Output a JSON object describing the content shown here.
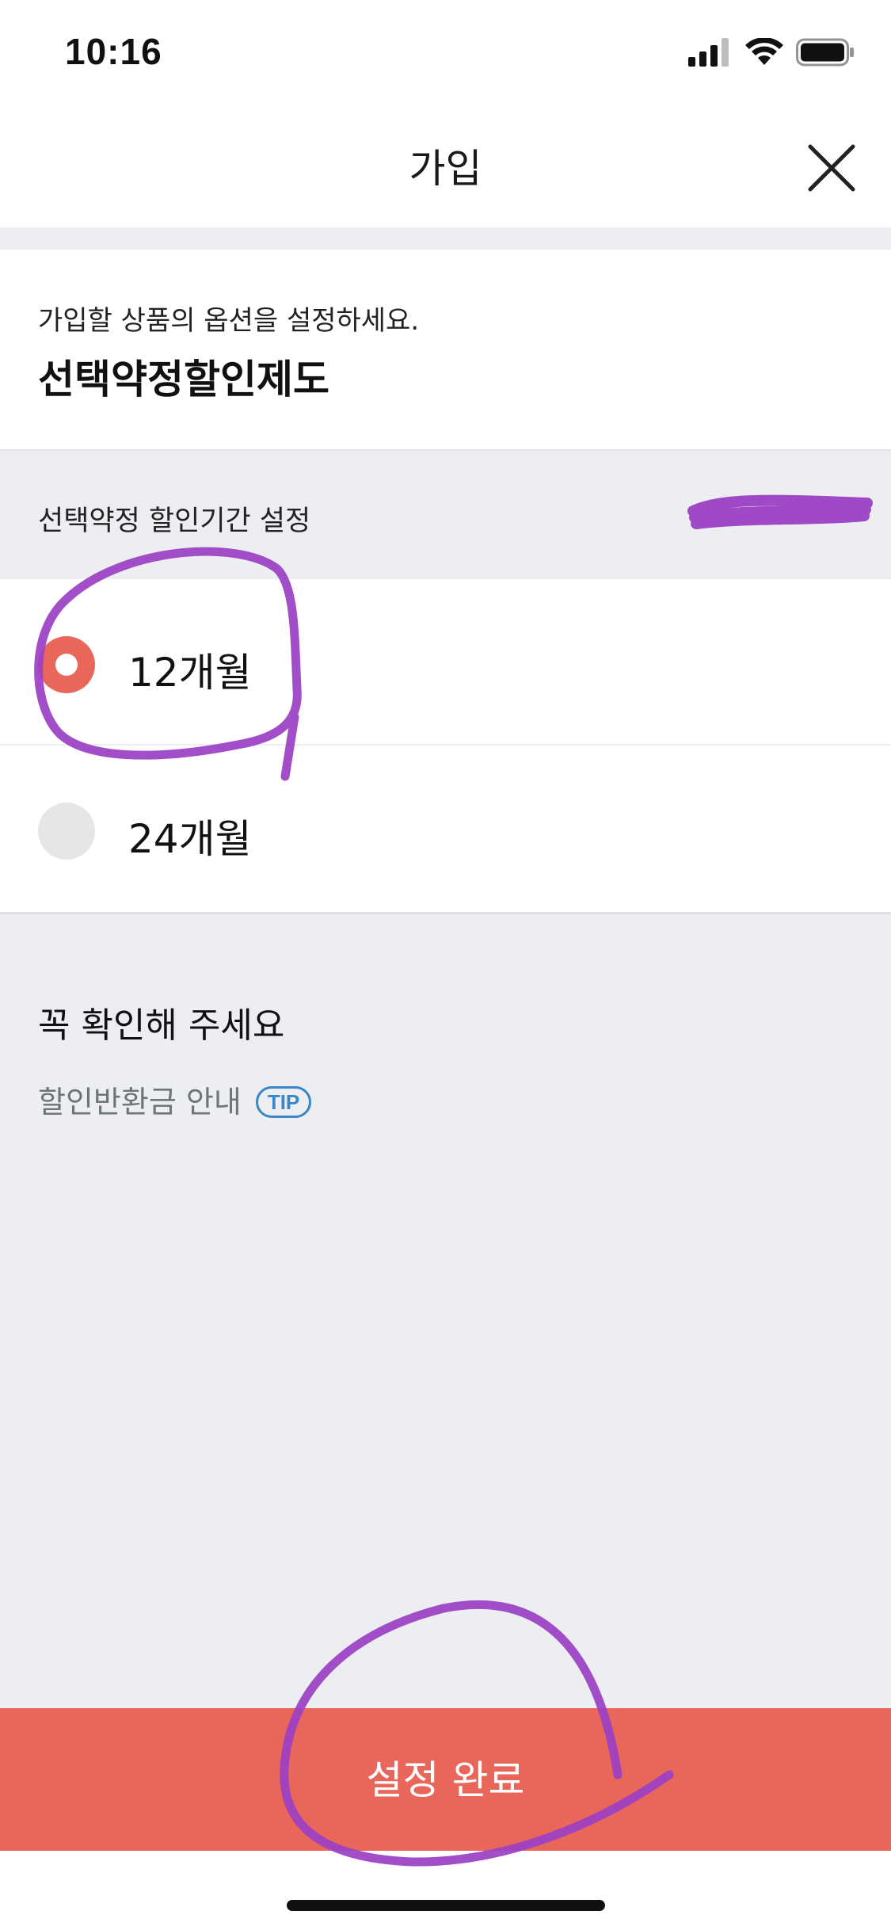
{
  "status_bar": {
    "time": "10:16",
    "icons": [
      "cellular-signal-icon",
      "wifi-icon",
      "battery-icon"
    ]
  },
  "header": {
    "title": "가입",
    "close_icon": "close-icon"
  },
  "product": {
    "subtitle": "가입할 상품의 옵션을 설정하세요.",
    "title": "선택약정할인제도"
  },
  "period": {
    "label": "선택약정 할인기간 설정",
    "options": [
      {
        "label": "12개월",
        "selected": true
      },
      {
        "label": "24개월",
        "selected": false
      }
    ]
  },
  "notice": {
    "title": "꼭 확인해 주세요",
    "link_label": "할인반환금 안내",
    "tip_badge": "TIP"
  },
  "confirm": {
    "label": "설정 완료"
  },
  "colors": {
    "accent": "#e8675a",
    "tip_blue": "#3a86c9",
    "background_gray": "#eceef1",
    "annotation_purple": "#9b3fc4"
  }
}
